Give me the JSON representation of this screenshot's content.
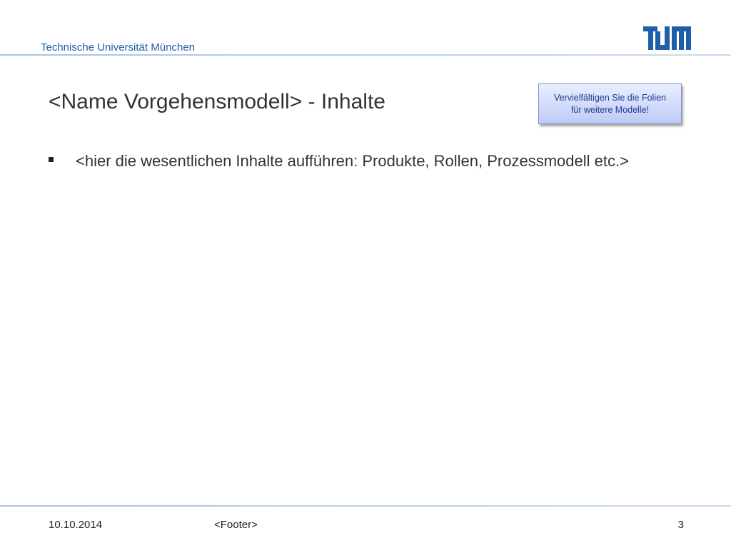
{
  "header": {
    "university": "Technische Universität München",
    "logo_icon": "tum-logo-icon",
    "logo_color": "#1f5ea8"
  },
  "slide": {
    "title": "<Name Vorgehensmodell> - Inhalte",
    "note_box": {
      "line1": "Vervielfältigen Sie die Folien",
      "line2": "für weitere Modelle!"
    },
    "bullets": [
      {
        "icon": "square-bullet-icon",
        "text": "<hier die wesentlichen Inhalte aufführen: Produkte, Rollen, Prozessmodell etc.>"
      }
    ]
  },
  "footer": {
    "date": "10.10.2014",
    "text": "<Footer>",
    "page_number": "3"
  },
  "colors": {
    "accent_blue": "#1f5ea8",
    "note_border": "#7d95c8",
    "text_dark": "#333333"
  }
}
